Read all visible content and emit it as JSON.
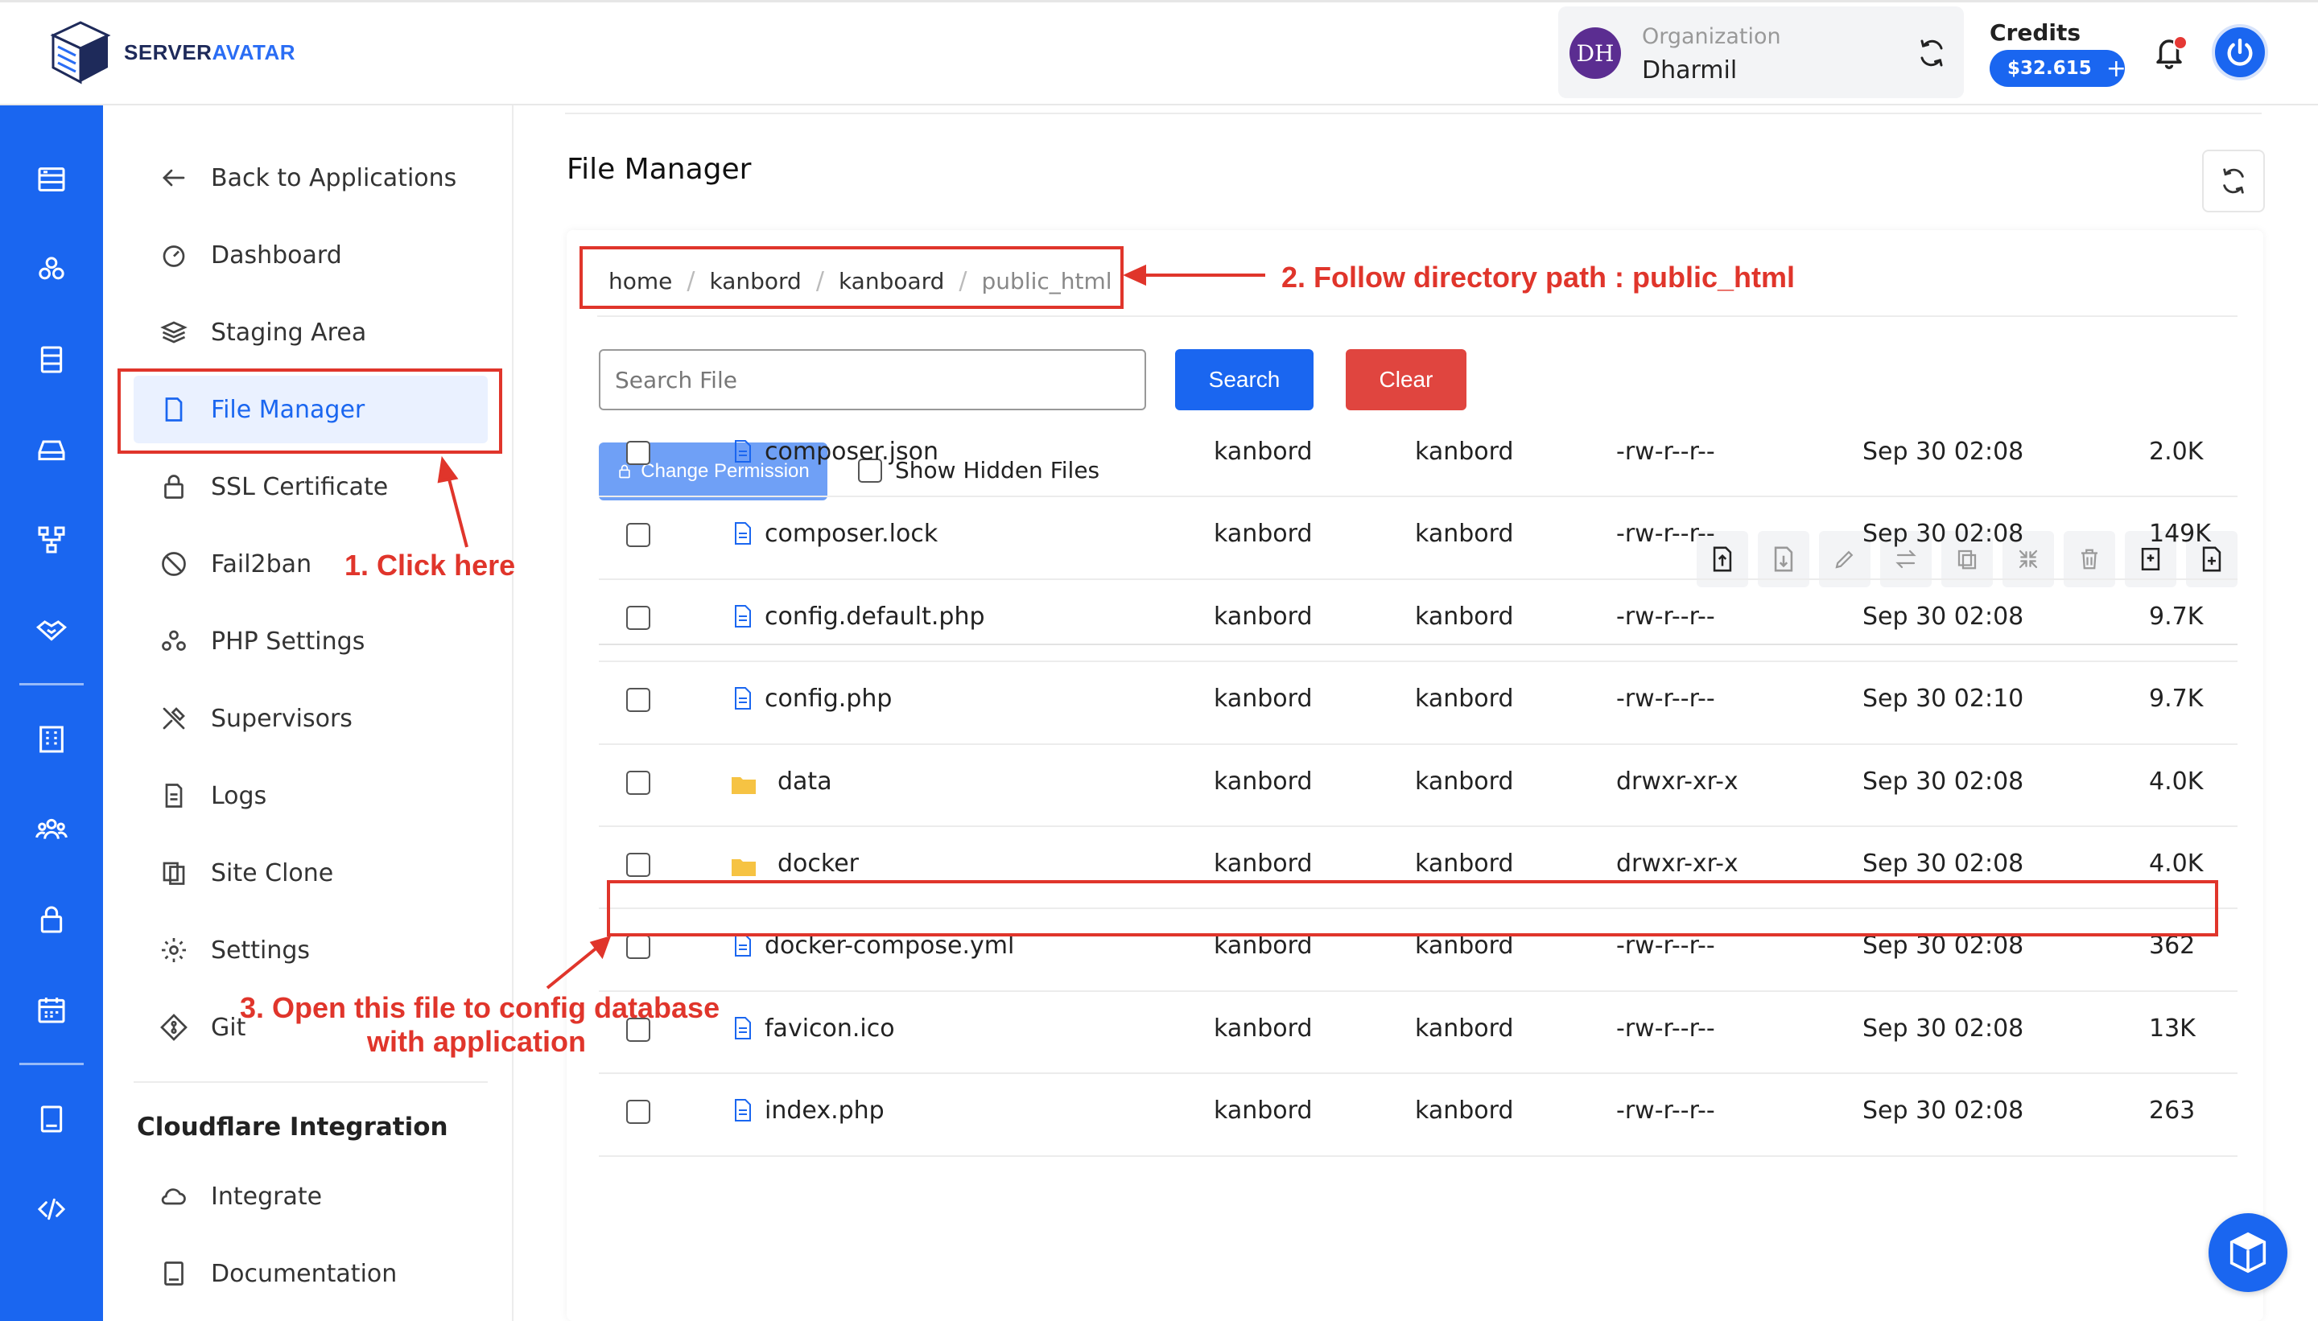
{
  "brand": {
    "part1": "SERVER",
    "part2": "AVATAR"
  },
  "header": {
    "org_initials": "DH",
    "org_label": "Organization",
    "org_name": "Dharmil",
    "credits_label": "Credits",
    "credits_value": "$32.615",
    "credits_add": "+"
  },
  "rail_icons": [
    "server-icon",
    "apps-icon",
    "database-icon",
    "disk-icon",
    "network-icon",
    "handshake-icon",
    "building-icon",
    "team-icon",
    "lock-icon",
    "calendar-icon",
    "book-icon",
    "code-icon"
  ],
  "sidebar": {
    "items": [
      {
        "label": "Back to Applications",
        "icon": "arrow-left-icon"
      },
      {
        "label": "Dashboard",
        "icon": "gauge-icon"
      },
      {
        "label": "Staging Area",
        "icon": "layers-icon"
      },
      {
        "label": "File Manager",
        "icon": "file-icon",
        "active": true
      },
      {
        "label": "SSL Certificate",
        "icon": "lock-icon"
      },
      {
        "label": "Fail2ban",
        "icon": "ban-icon"
      },
      {
        "label": "PHP Settings",
        "icon": "php-icon"
      },
      {
        "label": "Supervisors",
        "icon": "tools-icon"
      },
      {
        "label": "Logs",
        "icon": "document-icon"
      },
      {
        "label": "Site Clone",
        "icon": "clone-icon"
      },
      {
        "label": "Settings",
        "icon": "gear-icon"
      },
      {
        "label": "Git",
        "icon": "git-icon"
      }
    ],
    "section_title": "Cloudflare Integration",
    "section_items": [
      {
        "label": "Integrate",
        "icon": "cloud-icon"
      },
      {
        "label": "Documentation",
        "icon": "book-icon"
      }
    ]
  },
  "main": {
    "title": "File Manager",
    "breadcrumb": [
      "home",
      "kanbord",
      "kanboard",
      "public_html"
    ],
    "search_placeholder": "Search File",
    "search_label": "Search",
    "clear_label": "Clear",
    "change_permission_label": "Change Permission",
    "show_hidden_label": "Show Hidden Files",
    "toolbar_icons": [
      "upload-file-icon",
      "download-file-icon",
      "rename-icon",
      "move-icon",
      "copy-icon",
      "compress-icon",
      "delete-icon",
      "new-folder-icon",
      "new-file-icon"
    ],
    "files": [
      {
        "name": "composer.json",
        "type": "file",
        "owner": "kanbord",
        "group": "kanbord",
        "perm": "-rw-r--r--",
        "date": "Sep 30 02:08",
        "size": "2.0K"
      },
      {
        "name": "composer.lock",
        "type": "file",
        "owner": "kanbord",
        "group": "kanbord",
        "perm": "-rw-r--r--",
        "date": "Sep 30 02:08",
        "size": "149K"
      },
      {
        "name": "config.default.php",
        "type": "file",
        "owner": "kanbord",
        "group": "kanbord",
        "perm": "-rw-r--r--",
        "date": "Sep 30 02:08",
        "size": "9.7K"
      },
      {
        "name": "config.php",
        "type": "file",
        "owner": "kanbord",
        "group": "kanbord",
        "perm": "-rw-r--r--",
        "date": "Sep 30 02:10",
        "size": "9.7K"
      },
      {
        "name": "data",
        "type": "folder",
        "owner": "kanbord",
        "group": "kanbord",
        "perm": "drwxr-xr-x",
        "date": "Sep 30 02:08",
        "size": "4.0K"
      },
      {
        "name": "docker",
        "type": "folder",
        "owner": "kanbord",
        "group": "kanbord",
        "perm": "drwxr-xr-x",
        "date": "Sep 30 02:08",
        "size": "4.0K"
      },
      {
        "name": "docker-compose.yml",
        "type": "file",
        "owner": "kanbord",
        "group": "kanbord",
        "perm": "-rw-r--r--",
        "date": "Sep 30 02:08",
        "size": "362"
      },
      {
        "name": "favicon.ico",
        "type": "file",
        "owner": "kanbord",
        "group": "kanbord",
        "perm": "-rw-r--r--",
        "date": "Sep 30 02:08",
        "size": "13K"
      },
      {
        "name": "index.php",
        "type": "file",
        "owner": "kanbord",
        "group": "kanbord",
        "perm": "-rw-r--r--",
        "date": "Sep 30 02:08",
        "size": "263"
      }
    ]
  },
  "annotations": {
    "step1": "1. Click here",
    "step2": "2. Follow directory path : public_html",
    "step3_line1": "3. Open this file to config database",
    "step3_line2": "with application"
  },
  "colors": {
    "primary": "#1a66f0",
    "danger": "#e0453f",
    "annotation": "#e0352b",
    "folder": "#f6c343"
  }
}
